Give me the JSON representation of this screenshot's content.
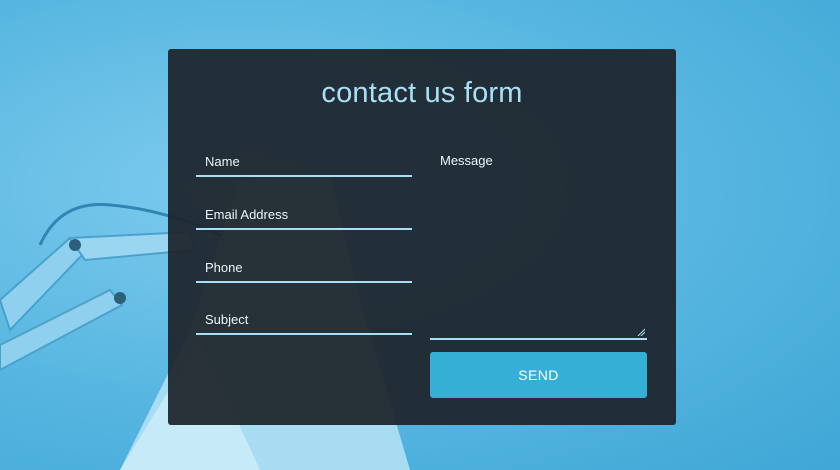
{
  "form": {
    "title": "contact us form",
    "name_placeholder": "Name",
    "email_placeholder": "Email Address",
    "phone_placeholder": "Phone",
    "subject_placeholder": "Subject",
    "message_placeholder": "Message",
    "send_label": "SEND"
  },
  "colors": {
    "background": "#5ab9e3",
    "card": "#1d242a",
    "accent": "#36afd6",
    "title": "#a9e0f7",
    "underline": "#a9dff4"
  }
}
